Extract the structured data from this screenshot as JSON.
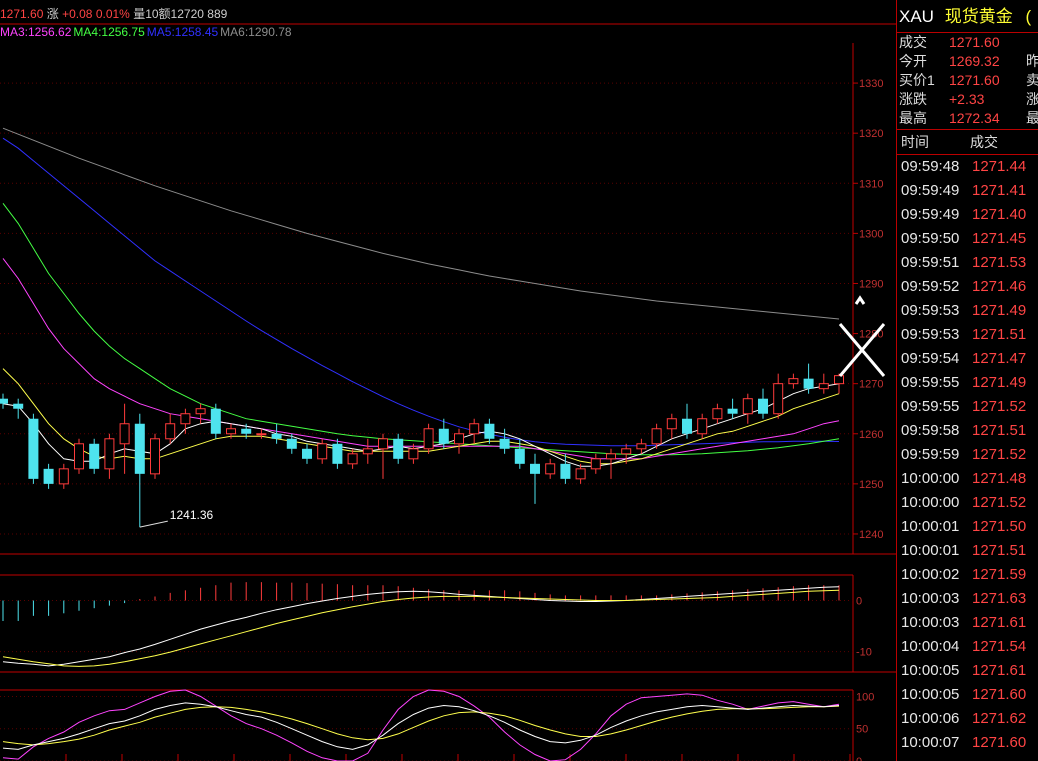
{
  "colors": {
    "up": "#ff3b3b",
    "down": "#4ee3ee",
    "grid": "#5a0000",
    "axis": "#c00000",
    "ma1": "#ffffff",
    "ma2": "#ffff4d",
    "ma3": "#ff44ff",
    "ma4": "#44ff44",
    "ma5": "#3030ff",
    "ma6": "#8c8c8c"
  },
  "header": {
    "price": "1271.60",
    "change_label": "涨",
    "change": "+0.08",
    "pct": "0.01%",
    "vol_label": "量10",
    "amount_label": "额12720",
    "amount_extra": "889"
  },
  "ma_labels": [
    {
      "text": "MA3:1256.62",
      "color": "#ff44ff"
    },
    {
      "text": "MA4:1256.75",
      "color": "#44ff44"
    },
    {
      "text": "MA5:1258.45",
      "color": "#3030ff"
    },
    {
      "text": "MA6:1290.78",
      "color": "#8c8c8c"
    }
  ],
  "quote": {
    "symbol": "XAU",
    "name": "现货黄金",
    "name_tail": "(",
    "rows": [
      {
        "label": "成交",
        "value": "1271.60",
        "label2": ""
      },
      {
        "label": "今开",
        "value": "1269.32",
        "label2": "昨"
      },
      {
        "label": "买价1",
        "value": "1271.60",
        "label2": "卖"
      },
      {
        "label": "涨跌",
        "value": "+2.33",
        "label2": "涨"
      },
      {
        "label": "最高",
        "value": "1272.34",
        "label2": "最"
      }
    ],
    "tick_header": {
      "time": "时间",
      "price": "成交"
    },
    "ticks": [
      {
        "time": "09:59:48",
        "price": "1271.44"
      },
      {
        "time": "09:59:49",
        "price": "1271.41"
      },
      {
        "time": "09:59:49",
        "price": "1271.40"
      },
      {
        "time": "09:59:50",
        "price": "1271.45"
      },
      {
        "time": "09:59:51",
        "price": "1271.53"
      },
      {
        "time": "09:59:52",
        "price": "1271.46"
      },
      {
        "time": "09:59:53",
        "price": "1271.49"
      },
      {
        "time": "09:59:53",
        "price": "1271.51"
      },
      {
        "time": "09:59:54",
        "price": "1271.47"
      },
      {
        "time": "09:59:55",
        "price": "1271.49"
      },
      {
        "time": "09:59:55",
        "price": "1271.52"
      },
      {
        "time": "09:59:58",
        "price": "1271.51"
      },
      {
        "time": "09:59:59",
        "price": "1271.52"
      },
      {
        "time": "10:00:00",
        "price": "1271.48"
      },
      {
        "time": "10:00:00",
        "price": "1271.52"
      },
      {
        "time": "10:00:01",
        "price": "1271.50"
      },
      {
        "time": "10:00:01",
        "price": "1271.51"
      },
      {
        "time": "10:00:02",
        "price": "1271.59"
      },
      {
        "time": "10:00:03",
        "price": "1271.63"
      },
      {
        "time": "10:00:03",
        "price": "1271.61"
      },
      {
        "time": "10:00:04",
        "price": "1271.54"
      },
      {
        "time": "10:00:05",
        "price": "1271.61"
      },
      {
        "time": "10:00:05",
        "price": "1271.60"
      },
      {
        "time": "10:00:06",
        "price": "1271.62"
      },
      {
        "time": "10:00:07",
        "price": "1271.60"
      }
    ]
  },
  "chart_data": {
    "type": "candlestick",
    "main": {
      "ylim": [
        1236,
        1338
      ],
      "yticks": [
        1240,
        1250,
        1260,
        1270,
        1280,
        1290,
        1300,
        1310,
        1320,
        1330
      ],
      "annotation": {
        "text": "1241.36",
        "value": 1241.36
      },
      "candles": [
        [
          1267,
          1268,
          1265,
          1266
        ],
        [
          1266,
          1267,
          1263,
          1265
        ],
        [
          1263,
          1264,
          1250,
          1251
        ],
        [
          1253,
          1254,
          1249,
          1250
        ],
        [
          1250,
          1254,
          1249,
          1253
        ],
        [
          1253,
          1259,
          1252,
          1258
        ],
        [
          1258,
          1259,
          1252,
          1253
        ],
        [
          1253,
          1260,
          1251,
          1259
        ],
        [
          1258,
          1266,
          1252,
          1262
        ],
        [
          1262,
          1264,
          1241.36,
          1252
        ],
        [
          1252,
          1260,
          1251,
          1259
        ],
        [
          1259,
          1264,
          1258,
          1262
        ],
        [
          1262,
          1265,
          1260,
          1264
        ],
        [
          1264,
          1266,
          1262,
          1265
        ],
        [
          1265,
          1266,
          1259,
          1260
        ],
        [
          1260,
          1262,
          1259,
          1261
        ],
        [
          1261,
          1262,
          1259,
          1260
        ],
        [
          1260,
          1261,
          1259,
          1260
        ],
        [
          1260,
          1262,
          1258,
          1259
        ],
        [
          1259,
          1260,
          1256,
          1257
        ],
        [
          1257,
          1258,
          1254,
          1255
        ],
        [
          1255,
          1259,
          1254,
          1258
        ],
        [
          1258,
          1259,
          1253,
          1254
        ],
        [
          1254,
          1257,
          1253,
          1256
        ],
        [
          1256,
          1259,
          1254,
          1257
        ],
        [
          1257,
          1260,
          1251,
          1259
        ],
        [
          1259,
          1260,
          1254,
          1255
        ],
        [
          1255,
          1258,
          1254,
          1257
        ],
        [
          1257,
          1262,
          1256,
          1261
        ],
        [
          1261,
          1263,
          1257,
          1258
        ],
        [
          1258,
          1261,
          1256,
          1260
        ],
        [
          1260,
          1263,
          1258,
          1262
        ],
        [
          1262,
          1263,
          1258,
          1259
        ],
        [
          1259,
          1261,
          1256,
          1257
        ],
        [
          1257,
          1259,
          1253,
          1254
        ],
        [
          1254,
          1256,
          1246,
          1252
        ],
        [
          1252,
          1255,
          1251,
          1254
        ],
        [
          1254,
          1256,
          1250,
          1251
        ],
        [
          1251,
          1254,
          1250,
          1253
        ],
        [
          1253,
          1256,
          1252,
          1255
        ],
        [
          1255,
          1257,
          1251,
          1256
        ],
        [
          1256,
          1258,
          1254,
          1257
        ],
        [
          1257,
          1259,
          1256,
          1258
        ],
        [
          1258,
          1262,
          1257,
          1261
        ],
        [
          1261,
          1264,
          1259,
          1263
        ],
        [
          1263,
          1266,
          1259,
          1260
        ],
        [
          1260,
          1264,
          1259,
          1263
        ],
        [
          1263,
          1266,
          1262,
          1265
        ],
        [
          1265,
          1267,
          1263,
          1264
        ],
        [
          1264,
          1268,
          1262,
          1267
        ],
        [
          1267,
          1269,
          1263,
          1264
        ],
        [
          1264,
          1272,
          1263,
          1270
        ],
        [
          1270,
          1272,
          1269,
          1271
        ],
        [
          1271,
          1274,
          1268,
          1269
        ],
        [
          1269,
          1272,
          1268,
          1270
        ],
        [
          1270,
          1272,
          1268,
          1271.6
        ]
      ],
      "ma1": [
        1266,
        1265.5,
        1262,
        1258,
        1255,
        1254.5,
        1254.5,
        1256,
        1257,
        1256.5,
        1256,
        1258,
        1261,
        1262,
        1262.5,
        1262,
        1261.5,
        1261,
        1260,
        1259.5,
        1258.5,
        1258,
        1257.5,
        1257,
        1256.5,
        1257,
        1257.5,
        1257,
        1257.5,
        1258,
        1259,
        1260,
        1260.5,
        1260,
        1259,
        1257.5,
        1256,
        1254.5,
        1253.5,
        1253.5,
        1254,
        1255,
        1256,
        1257.5,
        1259,
        1260,
        1261,
        1262,
        1263,
        1264,
        1265,
        1266.5,
        1268,
        1269,
        1269.5,
        1270
      ],
      "ma2": [
        1273,
        1270,
        1266,
        1262,
        1259,
        1257,
        1255.5,
        1255,
        1255.5,
        1255,
        1255,
        1256,
        1257,
        1258,
        1259,
        1259.5,
        1259.5,
        1259.5,
        1259,
        1258.5,
        1258,
        1257.5,
        1257,
        1256.5,
        1256.5,
        1256.5,
        1256.5,
        1256.5,
        1256.5,
        1257,
        1257.5,
        1258,
        1258.5,
        1258.5,
        1258,
        1257.5,
        1256.5,
        1255.5,
        1254.5,
        1254,
        1254,
        1254.5,
        1255,
        1256,
        1257,
        1258,
        1259,
        1260,
        1260.5,
        1261.5,
        1262.5,
        1263.5,
        1265,
        1266,
        1267,
        1268
      ],
      "ma3": [
        1295,
        1291,
        1286,
        1281,
        1277,
        1274,
        1271,
        1269,
        1267.5,
        1266,
        1265,
        1264,
        1263.5,
        1263,
        1262.5,
        1262,
        1261.5,
        1261,
        1260.5,
        1260,
        1259.5,
        1259,
        1258.5,
        1258,
        1257.5,
        1257.5,
        1257.5,
        1257.5,
        1257.5,
        1257.5,
        1257.5,
        1257.5,
        1257.5,
        1257.5,
        1257.5,
        1257,
        1256.5,
        1256,
        1255.5,
        1255,
        1255,
        1255,
        1255,
        1255.5,
        1256,
        1256.5,
        1257,
        1257.5,
        1258,
        1258.5,
        1259,
        1259.5,
        1260,
        1261,
        1262,
        1262.6
      ],
      "ma4": [
        1306,
        1302,
        1297,
        1292,
        1288,
        1284,
        1280.5,
        1277.5,
        1275,
        1273,
        1271,
        1269,
        1267.5,
        1266,
        1265,
        1264,
        1263,
        1262.5,
        1262,
        1261.5,
        1261,
        1260.5,
        1260,
        1259.6,
        1259.3,
        1259,
        1258.8,
        1258.6,
        1258.4,
        1258.2,
        1258,
        1257.8,
        1257.6,
        1257.4,
        1257.2,
        1257,
        1256.8,
        1256.6,
        1256.4,
        1256.2,
        1256,
        1255.9,
        1255.8,
        1255.8,
        1255.8,
        1255.9,
        1256,
        1256.2,
        1256.4,
        1256.6,
        1256.9,
        1257.2,
        1257.6,
        1258,
        1258.5,
        1259
      ],
      "ma5": [
        1319,
        1317,
        1314.5,
        1312,
        1309.5,
        1307,
        1304.5,
        1302,
        1299.5,
        1297,
        1294.5,
        1292.5,
        1290.5,
        1288.5,
        1286.5,
        1284.5,
        1282.5,
        1280.6,
        1278.8,
        1277,
        1275.3,
        1273.6,
        1272,
        1270.4,
        1268.9,
        1267.4,
        1266,
        1264.7,
        1263.5,
        1262.4,
        1261.4,
        1260.6,
        1259.9,
        1259.3,
        1258.8,
        1258.4,
        1258.1,
        1257.9,
        1257.8,
        1257.7,
        1257.6,
        1257.6,
        1257.6,
        1257.7,
        1257.8,
        1257.9,
        1258,
        1258.1,
        1258.2,
        1258.3,
        1258.4,
        1258.4,
        1258.5,
        1258.5,
        1258.5,
        1258.45
      ],
      "ma6": [
        1321,
        1319.8,
        1318.6,
        1317.4,
        1316.2,
        1315,
        1313.9,
        1312.8,
        1311.7,
        1310.6,
        1309.5,
        1308.5,
        1307.5,
        1306.5,
        1305.5,
        1304.5,
        1303.6,
        1302.7,
        1301.8,
        1300.9,
        1300,
        1299.2,
        1298.4,
        1297.6,
        1296.8,
        1296,
        1295.3,
        1294.6,
        1293.9,
        1293.3,
        1292.7,
        1292.1,
        1291.5,
        1291,
        1290.5,
        1290,
        1289.5,
        1289,
        1288.5,
        1288.1,
        1287.7,
        1287.3,
        1286.9,
        1286.5,
        1286.2,
        1285.9,
        1285.6,
        1285.3,
        1285,
        1284.7,
        1284.4,
        1284.1,
        1283.8,
        1283.5,
        1283.2,
        1282.9
      ]
    },
    "macd": {
      "ylim": [
        -14,
        5
      ],
      "yticks": [
        0,
        -10
      ],
      "hist": [
        -4,
        -4,
        -3,
        -3,
        -2.5,
        -2,
        -1.5,
        -1,
        -0.5,
        0.3,
        0.8,
        1.5,
        2,
        2.5,
        3,
        3.5,
        3.6,
        3.6,
        3.5,
        3.5,
        3.4,
        3.3,
        3.2,
        3,
        3,
        3,
        2.8,
        2.5,
        2.2,
        2,
        2,
        2,
        2,
        2,
        1.8,
        1.5,
        1.2,
        1,
        1,
        1,
        1,
        1,
        1,
        1,
        1.2,
        1.4,
        1.6,
        1.8,
        2,
        2.2,
        2.4,
        2.6,
        2.8,
        3,
        3,
        3
      ],
      "dif": [
        -12,
        -12.3,
        -12.5,
        -12.8,
        -12.5,
        -12,
        -11.5,
        -11,
        -10.2,
        -9.5,
        -8.6,
        -7.6,
        -6.6,
        -5.6,
        -4.8,
        -4,
        -3.3,
        -2.5,
        -1.8,
        -1.2,
        -0.6,
        -0.1,
        0.4,
        0.8,
        1.2,
        1.5,
        1.7,
        1.8,
        1.7,
        1.5,
        1.2,
        1,
        0.8,
        0.6,
        0.4,
        0.2,
        0,
        -0.1,
        -0.2,
        -0.2,
        -0.1,
        0,
        0.2,
        0.4,
        0.6,
        0.8,
        1,
        1.2,
        1.4,
        1.6,
        1.8,
        2,
        2.2,
        2.4,
        2.6,
        2.7
      ],
      "dea": [
        -11,
        -11.5,
        -12,
        -12.4,
        -12.8,
        -12.9,
        -12.8,
        -12.5,
        -12,
        -11.4,
        -10.8,
        -10.1,
        -9.3,
        -8.5,
        -7.7,
        -6.9,
        -6.1,
        -5.3,
        -4.5,
        -3.8,
        -3.1,
        -2.4,
        -1.8,
        -1.2,
        -0.7,
        -0.2,
        0.2,
        0.5,
        0.7,
        0.8,
        0.8,
        0.8,
        0.7,
        0.6,
        0.5,
        0.4,
        0.3,
        0.2,
        0.1,
        0,
        0,
        0,
        0.1,
        0.2,
        0.3,
        0.4,
        0.5,
        0.6,
        0.8,
        1,
        1.2,
        1.4,
        1.6,
        1.8,
        1.9,
        2
      ]
    },
    "kdj": {
      "ylim": [
        0,
        110
      ],
      "yticks": [
        100,
        50,
        0
      ],
      "k": [
        20,
        18,
        25,
        30,
        35,
        42,
        50,
        58,
        62,
        70,
        80,
        86,
        90,
        88,
        84,
        78,
        72,
        68,
        60,
        50,
        40,
        30,
        22,
        18,
        25,
        40,
        58,
        72,
        82,
        86,
        84,
        78,
        70,
        60,
        48,
        38,
        30,
        28,
        32,
        40,
        52,
        62,
        70,
        76,
        80,
        84,
        86,
        84,
        82,
        80,
        82,
        84,
        86,
        85,
        84,
        86
      ],
      "d": [
        30,
        27,
        25,
        27,
        30,
        34,
        40,
        48,
        54,
        60,
        68,
        74,
        80,
        83,
        84,
        83,
        80,
        76,
        71,
        65,
        58,
        50,
        42,
        36,
        33,
        35,
        42,
        52,
        62,
        70,
        75,
        76,
        74,
        70,
        63,
        55,
        48,
        42,
        38,
        38,
        42,
        48,
        55,
        62,
        68,
        73,
        77,
        80,
        81,
        81,
        81,
        82,
        83,
        84,
        84,
        85
      ],
      "j": [
        5,
        3,
        22,
        35,
        45,
        60,
        70,
        78,
        80,
        90,
        100,
        108,
        110,
        100,
        85,
        70,
        58,
        50,
        40,
        28,
        15,
        5,
        0,
        0,
        12,
        48,
        80,
        100,
        110,
        108,
        100,
        85,
        68,
        45,
        25,
        10,
        0,
        2,
        18,
        42,
        70,
        88,
        98,
        100,
        102,
        104,
        102,
        94,
        88,
        80,
        85,
        90,
        92,
        88,
        84,
        88
      ]
    }
  }
}
